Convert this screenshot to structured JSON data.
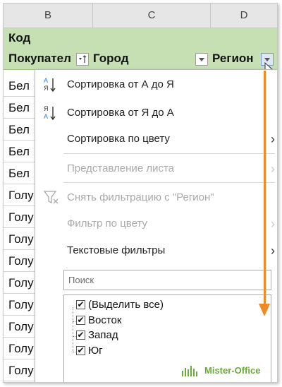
{
  "columns": {
    "b": "B",
    "c": "C",
    "d": "D"
  },
  "header": {
    "kod": "Код",
    "pokupatel": "Покупател",
    "gorod": "Город",
    "region": "Регион"
  },
  "rows": [
    "Бел",
    "Бел",
    "Бел",
    "Бел",
    "Бел",
    "Голу",
    "Голу",
    "Голу",
    "Голу",
    "Голу",
    "Голу",
    "Голу",
    "Голу",
    "Голу"
  ],
  "menu": {
    "sort_asc": "Сортировка от А до Я",
    "sort_desc": "Сортировка от Я до А",
    "sort_color": "Сортировка по цвету",
    "sheet_view": "Представление листа",
    "clear_filter": "Снять фильтрацию с \"Регион\"",
    "filter_color": "Фильтр по цвету",
    "text_filters": "Текстовые фильтры"
  },
  "search": {
    "placeholder": "Поиск"
  },
  "checklist": [
    {
      "label": "(Выделить все)",
      "checked": true
    },
    {
      "label": "Восток",
      "checked": true
    },
    {
      "label": "Запад",
      "checked": true
    },
    {
      "label": "Юг",
      "checked": true
    }
  ],
  "logo": {
    "text": "Mister-Office"
  },
  "colors": {
    "header_green": "#c6e0b4",
    "accent_orange": "#f08a24",
    "logo_green": "#6aaa3a",
    "icon_blue": "#2b7cd3"
  }
}
